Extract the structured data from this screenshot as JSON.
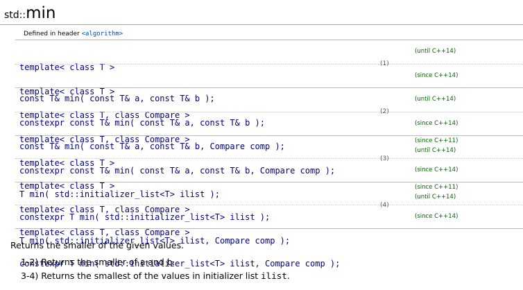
{
  "title": {
    "namespace": "std::",
    "function": "min"
  },
  "defined": {
    "label": "Defined in header ",
    "header": "<algorithm>"
  },
  "overloads": [
    {
      "number": "(1)",
      "variants": [
        {
          "lines": [
            "template< class T >",
            "const T& min( const T& a, const T& b );"
          ],
          "versions": [
            "(until C++14)"
          ]
        },
        {
          "lines": [
            "template< class T >",
            "constexpr const T& min( const T& a, const T& b );"
          ],
          "versions": [
            "(since C++14)"
          ]
        }
      ]
    },
    {
      "number": "(2)",
      "variants": [
        {
          "lines": [
            "template< class T, class Compare >",
            "const T& min( const T& a, const T& b, Compare comp );"
          ],
          "versions": [
            "(until C++14)"
          ]
        },
        {
          "lines": [
            "template< class T, class Compare >",
            "constexpr const T& min( const T& a, const T& b, Compare comp );"
          ],
          "versions": [
            "(since C++14)"
          ]
        }
      ]
    },
    {
      "number": "(3)",
      "variants": [
        {
          "lines": [
            "template< class T >",
            "T min( std::initializer_list<T> ilist );"
          ],
          "versions": [
            "(since C++11)",
            "(until C++14)"
          ]
        },
        {
          "lines": [
            "template< class T >",
            "constexpr T min( std::initializer_list<T> ilist );"
          ],
          "versions": [
            "(since C++14)"
          ]
        }
      ]
    },
    {
      "number": "(4)",
      "variants": [
        {
          "lines": [
            "template< class T, class Compare >",
            "T min( std::initializer_list<T> ilist, Compare comp );"
          ],
          "versions": [
            "(since C++11)",
            "(until C++14)"
          ]
        },
        {
          "lines": [
            "template< class T, class Compare >",
            "constexpr T min( std::initializer_list<T> ilist, Compare comp );"
          ],
          "versions": [
            "(since C++14)"
          ]
        }
      ]
    }
  ],
  "description": "Returns the smaller of the given values.",
  "items": [
    {
      "prefix": "1-2) Returns the smaller of ",
      "a": "a",
      "mid": " and ",
      "b": "b",
      "suffix": "."
    },
    {
      "prefix": "3-4) Returns the smallest of the values in initializer list ",
      "code": "ilist",
      "suffix": "."
    }
  ]
}
